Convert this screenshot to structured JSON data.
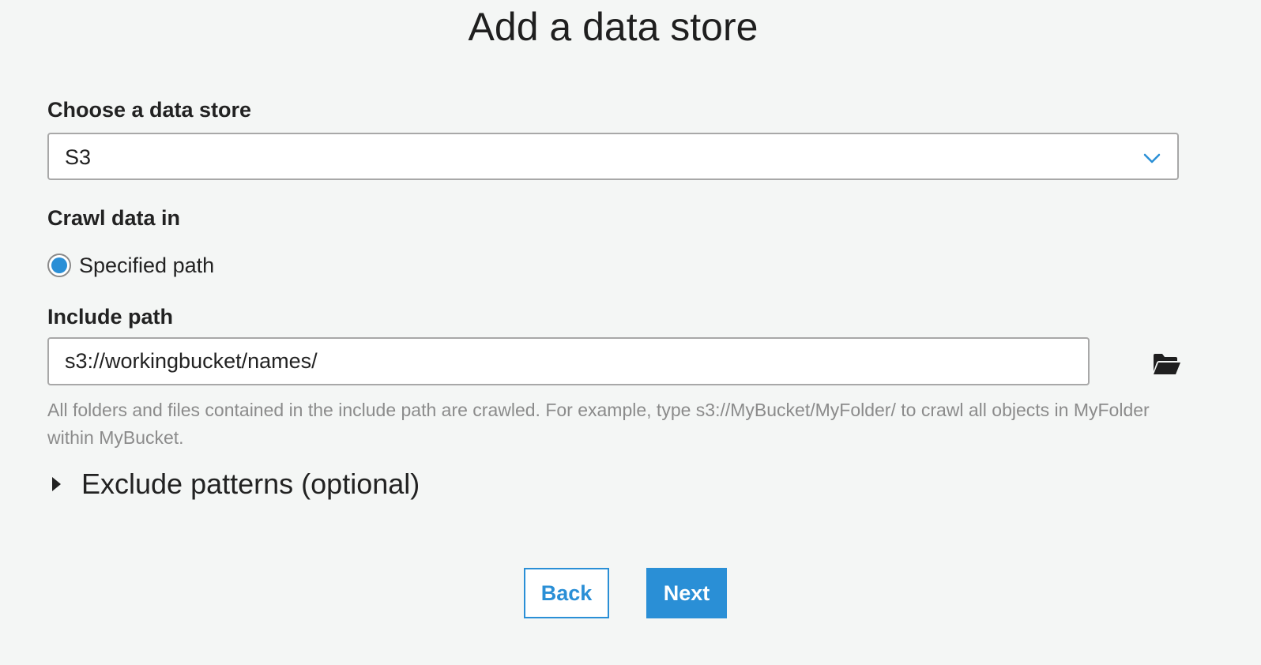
{
  "page": {
    "title": "Add a data store"
  },
  "data_store": {
    "label": "Choose a data store",
    "selected": "S3",
    "icon": "chevron-down-icon"
  },
  "crawl": {
    "label": "Crawl data in",
    "option_label": "Specified path",
    "selected": true
  },
  "include_path": {
    "label": "Include path",
    "value": "s3://workingbucket/names/",
    "browse_icon": "folder-open-icon",
    "help_text": "All folders and files contained in the include path are crawled. For example, type s3://MyBucket/MyFolder/ to crawl all objects in MyFolder within MyBucket."
  },
  "exclude": {
    "label": "Exclude patterns (optional)",
    "icon": "caret-right-icon"
  },
  "actions": {
    "back_label": "Back",
    "next_label": "Next"
  },
  "colors": {
    "accent": "#2a8fd6",
    "background": "#f4f6f5",
    "help_text": "#8b8b8b"
  }
}
